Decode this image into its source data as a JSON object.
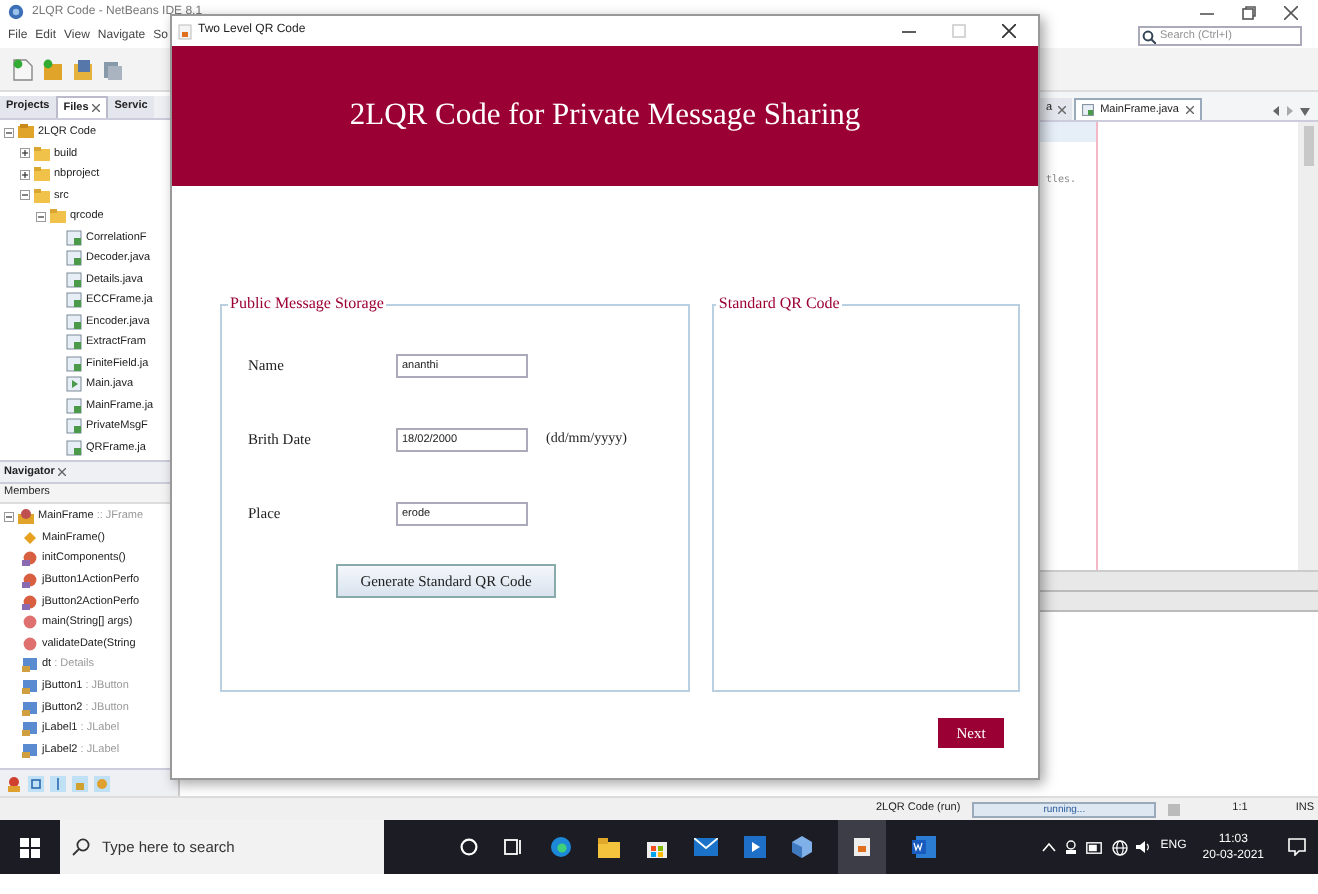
{
  "ide": {
    "title": "2LQR Code - NetBeans IDE 8.1",
    "menu": [
      "File",
      "Edit",
      "View",
      "Navigate",
      "So"
    ],
    "search": {
      "placeholder": "Search (Ctrl+I)"
    },
    "panel_tabs": [
      {
        "label": "Projects",
        "closable": false,
        "selected": false
      },
      {
        "label": "Files",
        "closable": true,
        "selected": true
      },
      {
        "label": "Servic",
        "closable": false,
        "selected": false
      }
    ],
    "project_tree": [
      {
        "label": "2LQR Code",
        "kind": "project",
        "expanded": true,
        "children": [
          {
            "label": "build",
            "kind": "folder",
            "expanded": false
          },
          {
            "label": "nbproject",
            "kind": "folder",
            "expanded": false
          },
          {
            "label": "src",
            "kind": "folder",
            "expanded": true,
            "children": [
              {
                "label": "qrcode",
                "kind": "package",
                "expanded": true,
                "children": [
                  {
                    "label": "CorrelationF",
                    "kind": "file"
                  },
                  {
                    "label": "Decoder.java",
                    "kind": "file"
                  },
                  {
                    "label": "Details.java",
                    "kind": "file"
                  },
                  {
                    "label": "ECCFrame.ja",
                    "kind": "file"
                  },
                  {
                    "label": "Encoder.java",
                    "kind": "file"
                  },
                  {
                    "label": "ExtractFram",
                    "kind": "file"
                  },
                  {
                    "label": "FiniteField.ja",
                    "kind": "file"
                  },
                  {
                    "label": "Main.java",
                    "kind": "main"
                  },
                  {
                    "label": "MainFrame.ja",
                    "kind": "file"
                  },
                  {
                    "label": "PrivateMsgF",
                    "kind": "file"
                  },
                  {
                    "label": "QRFrame.ja",
                    "kind": "file"
                  }
                ]
              }
            ]
          }
        ]
      }
    ],
    "navigator": {
      "title": "Navigator",
      "header": "Members",
      "items": [
        {
          "name": "MainFrame",
          "type": ":: JFrame",
          "kind": "class",
          "children": [
            {
              "name": "MainFrame()",
              "kind": "constructor"
            },
            {
              "name": "initComponents()",
              "kind": "method"
            },
            {
              "name": "jButton1ActionPerfo",
              "kind": "method"
            },
            {
              "name": "jButton2ActionPerfo",
              "kind": "method"
            },
            {
              "name": "main(String[] args)",
              "kind": "static"
            },
            {
              "name": "validateDate(String",
              "kind": "static"
            },
            {
              "name": "dt",
              "type": ": Details",
              "kind": "field"
            },
            {
              "name": "jButton1",
              "type": ": JButton",
              "kind": "field"
            },
            {
              "name": "jButton2",
              "type": ": JButton",
              "kind": "field"
            },
            {
              "name": "jLabel1",
              "type": ": JLabel",
              "kind": "field"
            },
            {
              "name": "jLabel2",
              "type": ": JLabel",
              "kind": "field"
            }
          ]
        }
      ]
    },
    "editor_tabs": [
      {
        "label": "a",
        "selected": false
      },
      {
        "label": "MainFrame.java",
        "selected": true
      }
    ],
    "code_text": "tles.",
    "status_bar": {
      "project": "2LQR Code (run)",
      "progress_text": "running...",
      "level": 1,
      "position": "1:1",
      "mode": "INS"
    }
  },
  "dialog": {
    "title": "Two Level QR Code",
    "heading": "2LQR Code for Private Message Sharing",
    "storage_panel": {
      "title": "Public Message Storage",
      "fields": [
        {
          "label": "Name",
          "value": "ananthi"
        },
        {
          "label": "Brith Date",
          "value": "18/02/2000",
          "hint": "(dd/mm/yyyy)"
        },
        {
          "label": "Place",
          "value": "erode"
        }
      ],
      "button": "Generate Standard QR Code"
    },
    "qr_panel": {
      "title": "Standard QR Code"
    },
    "next_button": "Next"
  },
  "taskbar": {
    "search_placeholder": "Type here to search",
    "language": "ENG",
    "time": "11:03",
    "date": "20-03-2021"
  }
}
